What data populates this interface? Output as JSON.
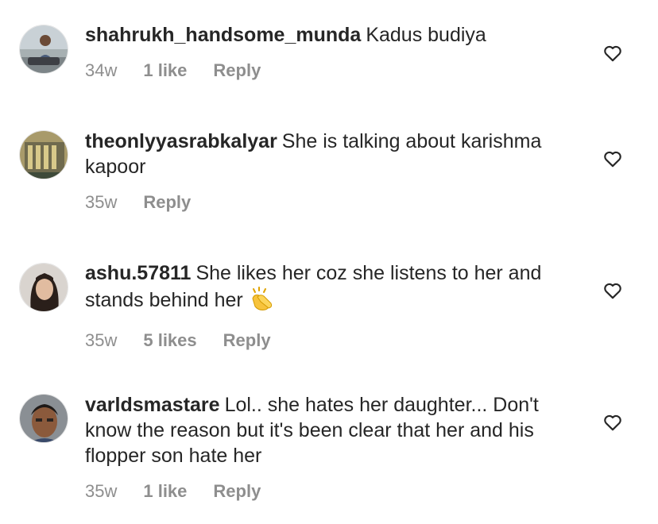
{
  "comments": [
    {
      "username": "shahrukh_handsome_munda",
      "text": "Kadus budiya",
      "time": "34w",
      "likes": "1 like",
      "reply": "Reply",
      "avatar_icon": "avatar-man-car-photo",
      "like_icon": "heart-outline-icon"
    },
    {
      "username": "theonlyyasrabkalyar",
      "text": "She is talking about karishma kapoor",
      "time": "35w",
      "likes": "",
      "reply": "Reply",
      "avatar_icon": "avatar-building-photo",
      "like_icon": "heart-outline-icon"
    },
    {
      "username": "ashu.57811",
      "text": "She likes her coz she listens to her and stands behind her",
      "emoji": "clapping-hands",
      "time": "35w",
      "likes": "5 likes",
      "reply": "Reply",
      "avatar_icon": "avatar-woman-photo",
      "like_icon": "heart-outline-icon"
    },
    {
      "username": "varldsmastare",
      "text": "Lol.. she hates her daughter... Don't know the reason but it's been clear that her and his flopper son hate her",
      "time": "35w",
      "likes": "1 like",
      "reply": "Reply",
      "avatar_icon": "avatar-man-selfie-photo",
      "like_icon": "heart-outline-icon"
    }
  ],
  "colors": {
    "text": "#262626",
    "meta": "#8e8e8e",
    "background": "#ffffff"
  }
}
